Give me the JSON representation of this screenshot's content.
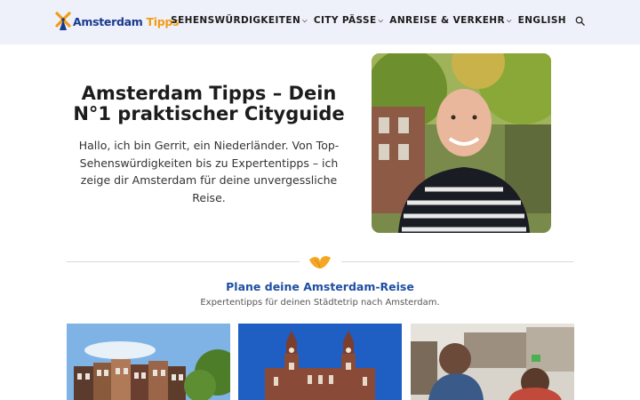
{
  "header": {
    "logo_name": "Amsterdam",
    "logo_suffix": "Tipps",
    "nav": [
      {
        "label": "SEHENSWÜRDIGKEITEN",
        "dropdown": true
      },
      {
        "label": "CITY PÄSSE",
        "dropdown": true
      },
      {
        "label": "ANREISE & VERKEHR",
        "dropdown": true
      },
      {
        "label": "ENGLISH",
        "dropdown": false
      }
    ],
    "search_icon": "search-icon"
  },
  "hero": {
    "title": "Amsterdam Tipps – Dein N°1 praktischer Cityguide",
    "text": "Hallo, ich bin Gerrit, ein Niederländer. Von Top-Sehenswürdigkeiten bis zu Expertentipps – ich zeige dir Amsterdam für deine unvergessliche Reise."
  },
  "section": {
    "title": "Plane deine Amsterdam-Reise",
    "subtitle": "Expertentipps für deinen Städtetrip nach Amsterdam."
  },
  "colors": {
    "header_bg": "#eef0fa",
    "brand_blue": "#1a3a8f",
    "brand_orange": "#f39c12",
    "section_title": "#1f4fa3"
  }
}
